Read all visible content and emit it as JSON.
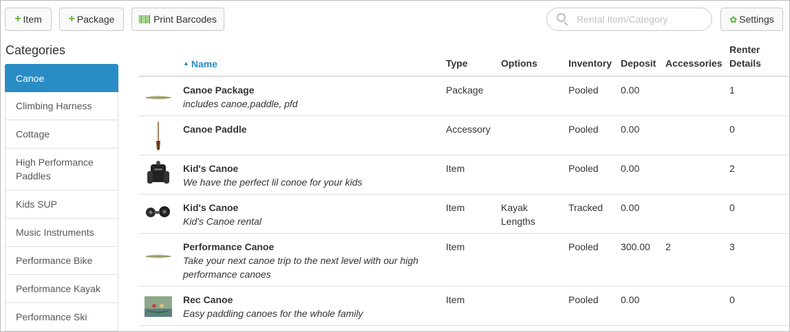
{
  "toolbar": {
    "item_label": "Item",
    "package_label": "Package",
    "print_label": "Print Barcodes",
    "settings_label": "Settings",
    "search_placeholder": "Rental Item/Category",
    "plus_icon": "plus-icon",
    "barcode_icon": "barcode-icon",
    "gear_icon": "gear-icon",
    "accent_color": "#5cb030"
  },
  "sidebar": {
    "heading": "Categories",
    "active_color": "#2a8cc4",
    "items": [
      {
        "label": "Canoe",
        "active": true
      },
      {
        "label": "Climbing Harness"
      },
      {
        "label": "Cottage"
      },
      {
        "label": "High Performance Paddles"
      },
      {
        "label": "Kids SUP"
      },
      {
        "label": "Music Instruments"
      },
      {
        "label": "Performance Bike"
      },
      {
        "label": "Performance Kayak"
      },
      {
        "label": "Performance Ski"
      }
    ]
  },
  "table": {
    "headers": {
      "name": "Name",
      "type": "Type",
      "options": "Options",
      "inventory": "Inventory",
      "deposit": "Deposit",
      "accessories": "Accessories",
      "renter_details_line1": "Renter",
      "renter_details_line2": "Details"
    },
    "rows": [
      {
        "thumb": "canoe-thumbnail",
        "name": "Canoe Package",
        "description": "includes canoe,paddle, pfd",
        "type": "Package",
        "options": "",
        "inventory": "Pooled",
        "deposit": "0.00",
        "accessories": "",
        "renter_details": "1"
      },
      {
        "thumb": "paddle-thumbnail",
        "name": "Canoe Paddle",
        "description": "",
        "type": "Accessory",
        "options": "",
        "inventory": "Pooled",
        "deposit": "0.00",
        "accessories": "",
        "renter_details": "0"
      },
      {
        "thumb": "dive-vest-thumbnail",
        "name": "Kid's Canoe",
        "description": "We have the perfect lil conoe for your kids",
        "type": "Item",
        "options": "",
        "inventory": "Pooled",
        "deposit": "0.00",
        "accessories": "",
        "renter_details": "2"
      },
      {
        "thumb": "regulator-thumbnail",
        "name": "Kid's Canoe",
        "description": "Kid's Canoe rental",
        "type": "Item",
        "options": "Kayak Lengths",
        "inventory": "Tracked",
        "deposit": "0.00",
        "accessories": "",
        "renter_details": "0"
      },
      {
        "thumb": "canoe-thumbnail",
        "name": "Performance Canoe",
        "description": "Take your next canoe trip to the next level with our high performance canoes",
        "type": "Item",
        "options": "",
        "inventory": "Pooled",
        "deposit": "300.00",
        "accessories": "2",
        "renter_details": "3"
      },
      {
        "thumb": "canoe-photo-thumbnail",
        "name": "Rec Canoe",
        "description": "Easy paddling canoes for the whole family",
        "type": "Item",
        "options": "",
        "inventory": "Pooled",
        "deposit": "0.00",
        "accessories": "",
        "renter_details": "0"
      }
    ]
  }
}
